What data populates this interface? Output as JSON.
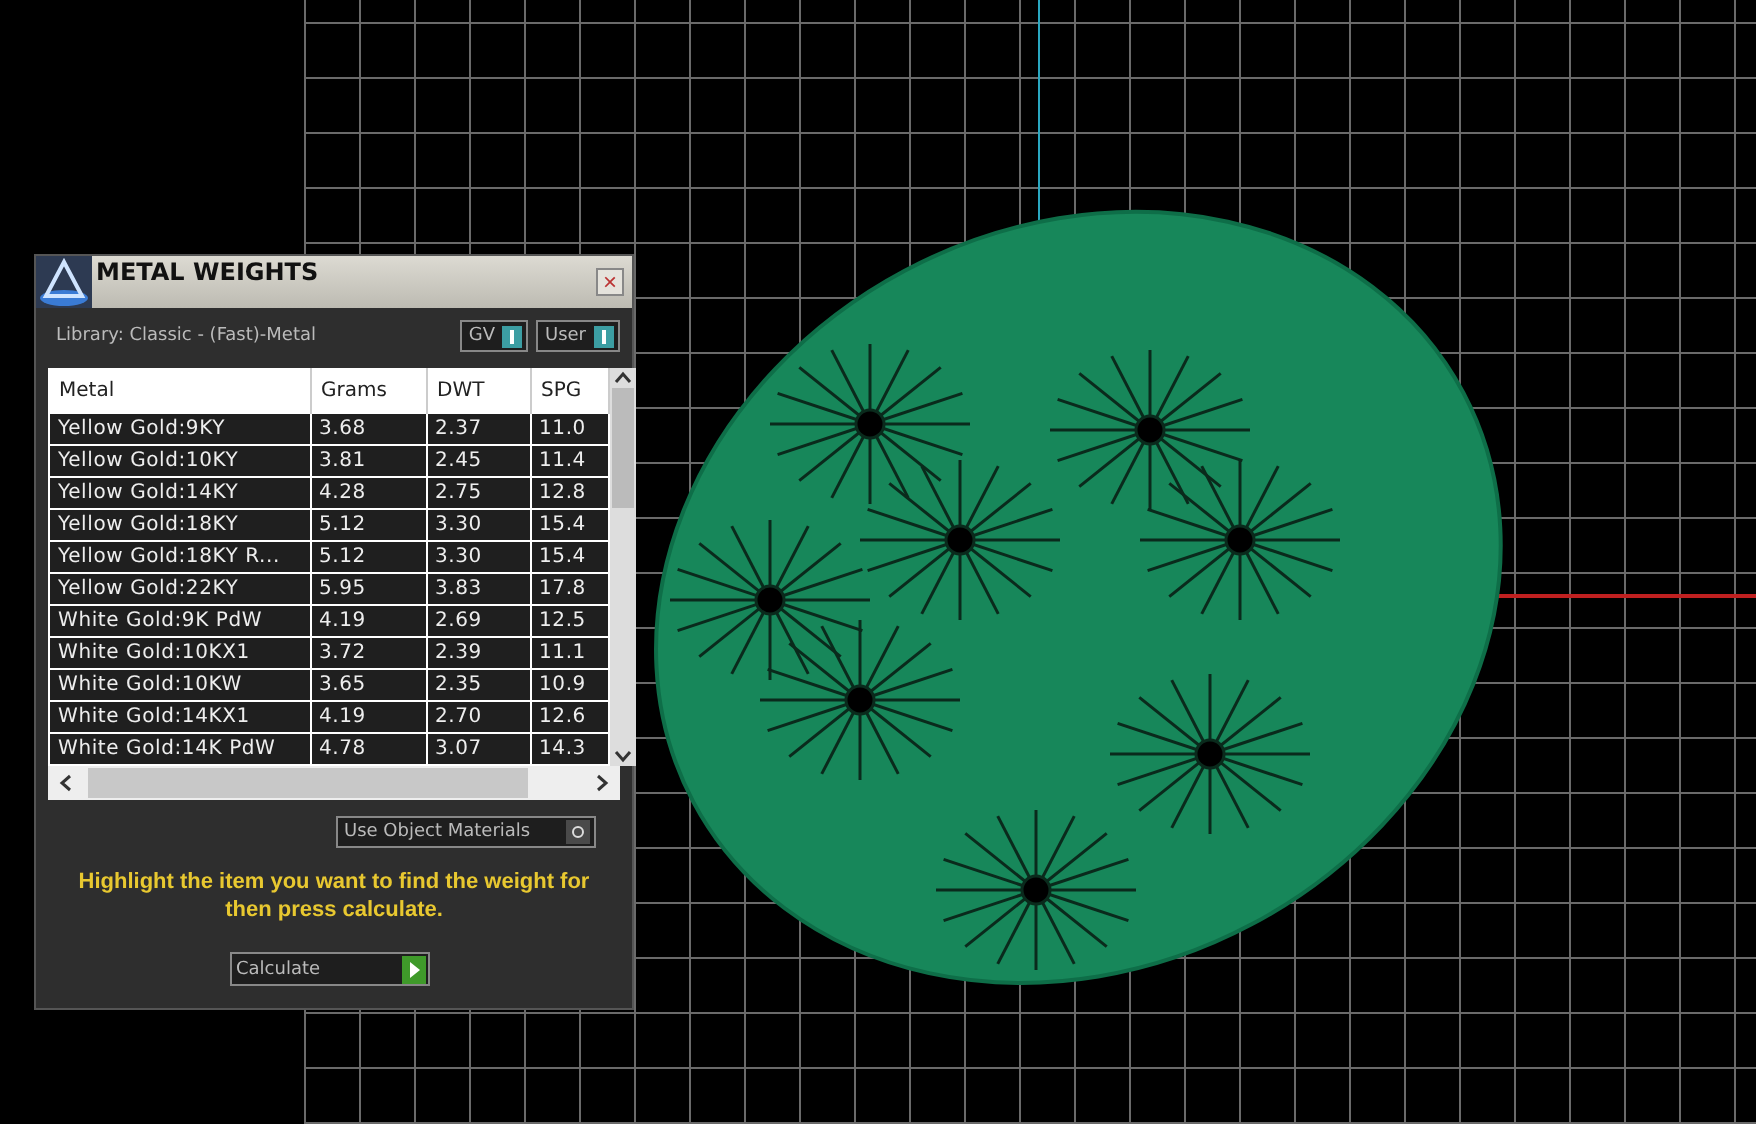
{
  "dialog": {
    "title": "METAL WEIGHTS",
    "close": "×",
    "library": "Library: Classic - (Fast)-Metal",
    "toggles": [
      {
        "label": "GV",
        "on": true
      },
      {
        "label": "User",
        "on": true
      }
    ],
    "table": {
      "columns": [
        "Metal",
        "Grams",
        "DWT",
        "SPG"
      ],
      "rows": [
        [
          "Yellow Gold:9KY",
          "3.68",
          "2.37",
          "11.0"
        ],
        [
          "Yellow Gold:10KY",
          "3.81",
          "2.45",
          "11.4"
        ],
        [
          "Yellow Gold:14KY",
          "4.28",
          "2.75",
          "12.8"
        ],
        [
          "Yellow Gold:18KY",
          "5.12",
          "3.30",
          "15.4"
        ],
        [
          "Yellow Gold:18KY R...",
          "5.12",
          "3.30",
          "15.4"
        ],
        [
          "Yellow Gold:22KY",
          "5.95",
          "3.83",
          "17.8"
        ],
        [
          "White Gold:9K PdW",
          "4.19",
          "2.69",
          "12.5"
        ],
        [
          "White Gold:10KX1",
          "3.72",
          "2.39",
          "11.1"
        ],
        [
          "White Gold:10KW",
          "3.65",
          "2.35",
          "10.9"
        ],
        [
          "White Gold:14KX1",
          "4.19",
          "2.70",
          "12.6"
        ],
        [
          "White Gold:14K PdW",
          "4.78",
          "3.07",
          "14.3"
        ]
      ]
    },
    "use_object_materials": {
      "label": "Use Object Materials",
      "on": false
    },
    "hint": "Highlight the item you want to find the weight for then press calculate.",
    "calculate": "Calculate"
  }
}
